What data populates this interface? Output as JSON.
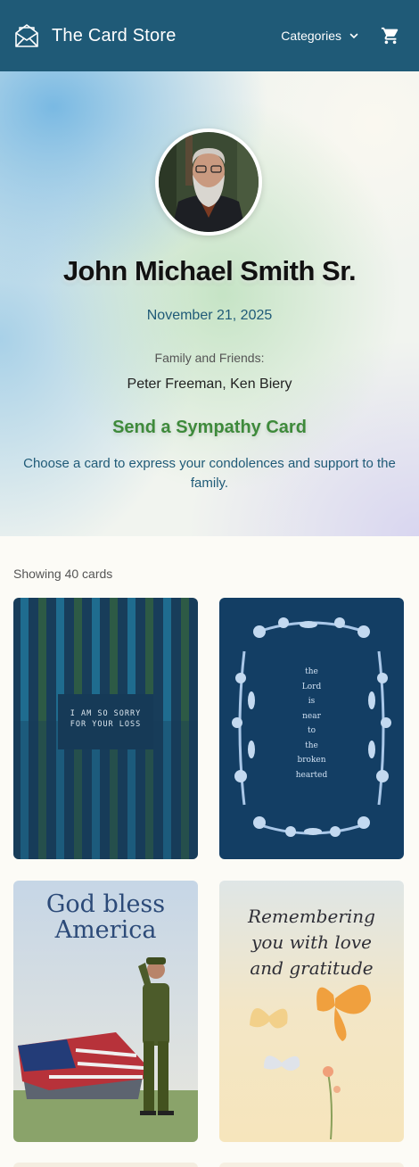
{
  "header": {
    "brand": "The Card Store",
    "categories_label": "Categories",
    "colors": {
      "header_bg": "#1f5a77"
    },
    "icons": {
      "logo": "envelope-icon",
      "dropdown": "chevron-down-icon",
      "cart": "cart-icon"
    }
  },
  "memorial": {
    "name": "John Michael Smith Sr.",
    "date": "November 21, 2025",
    "family_label": "Family and Friends:",
    "family_names": "Peter Freeman, Ken Biery",
    "cta_title": "Send a Sympathy Card",
    "cta_subtitle": "Choose a card to express your condolences and support to the family."
  },
  "results": {
    "count_text": "Showing 40 cards"
  },
  "cards": [
    {
      "text_line1": "I AM SO SORRY",
      "text_line2": "FOR YOUR LOSS"
    },
    {
      "lines": [
        "the",
        "Lord",
        "is",
        "near",
        "to",
        "the",
        "broken",
        "hearted"
      ]
    },
    {
      "line1": "God bless",
      "line2": "America"
    },
    {
      "line1": "Remembering",
      "line2": "you with love",
      "line3": "and gratitude"
    }
  ],
  "colors": {
    "green_accent": "#3e8a3b",
    "teal_text": "#1f5a77"
  }
}
